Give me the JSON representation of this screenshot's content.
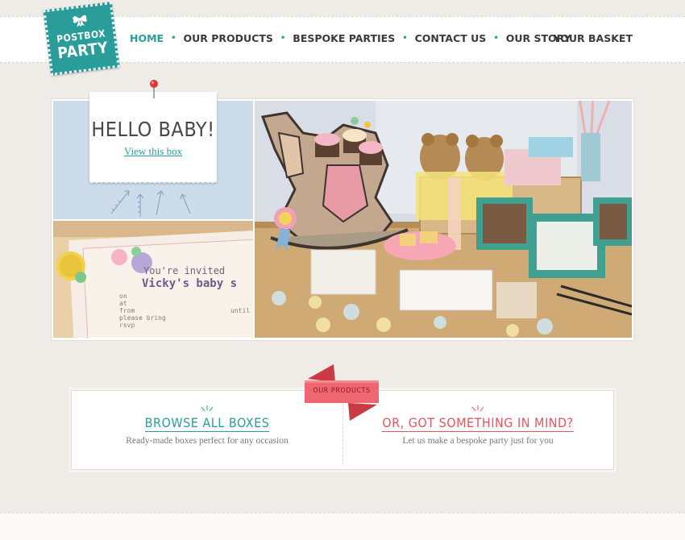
{
  "logo": {
    "line1": "POSTBOX",
    "line2": "PARTY",
    "brand_color": "#2a9d9a"
  },
  "nav": {
    "items": [
      {
        "label": "HOME",
        "active": true
      },
      {
        "label": "OUR PRODUCTS",
        "active": false
      },
      {
        "label": "BESPOKE PARTIES",
        "active": false
      },
      {
        "label": "CONTACT US",
        "active": false
      },
      {
        "label": "OUR STORY",
        "active": false
      }
    ],
    "separator": "•",
    "basket": "YOUR BASKET"
  },
  "hero": {
    "title": "HELLO BABY!",
    "link": "View this box",
    "pin_icon": "pushpin-icon",
    "invite_text": {
      "line1": "You're invited",
      "line2": "Vicky's baby s",
      "fields": [
        "on",
        "at",
        "from",
        "until",
        "please bring",
        "rsvp"
      ]
    }
  },
  "products": {
    "ribbon_label": "OUR PRODUCTS",
    "left": {
      "title": "BROWSE ALL BOXES",
      "subtitle": "Ready-made boxes perfect for any occasion"
    },
    "right": {
      "title": "OR, GOT SOMETHING IN MIND?",
      "subtitle": "Let us make a bespoke party just for you"
    }
  },
  "colors": {
    "accent": "#2a9d9a",
    "ribbon": "#e4555f",
    "background": "#efebe6"
  }
}
